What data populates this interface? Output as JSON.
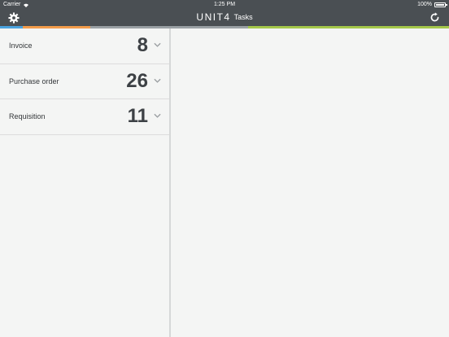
{
  "status_bar": {
    "carrier": "Carrier",
    "time": "1:25 PM",
    "battery": "100%"
  },
  "nav": {
    "logo": "UNIT4",
    "title": "Tasks",
    "icons": {
      "left": "gear-icon",
      "right": "refresh-icon"
    }
  },
  "accent_colors": [
    "#4aa3df",
    "#f39c4a",
    "#9aa0a4",
    "#a5c84a"
  ],
  "tasks": [
    {
      "label": "Invoice",
      "count": "8"
    },
    {
      "label": "Purchase order",
      "count": "26"
    },
    {
      "label": "Requisition",
      "count": "11"
    }
  ]
}
